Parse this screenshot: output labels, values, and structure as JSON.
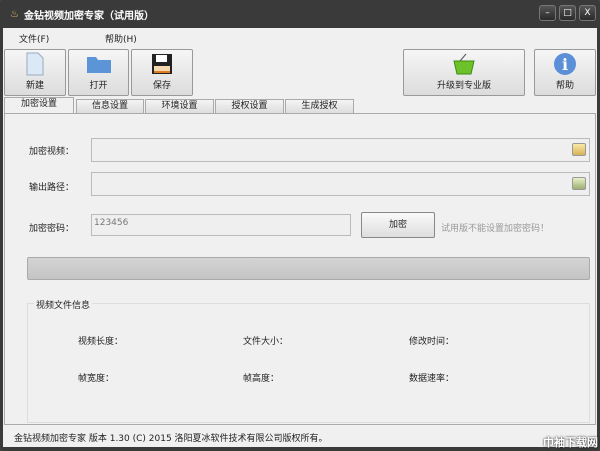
{
  "window": {
    "title": "金钻视频加密专家（试用版）",
    "minimize": "–",
    "maximize": "□",
    "close": "X"
  },
  "menu": [
    "文件(F)",
    "帮助(H)"
  ],
  "toolbar": {
    "new": "新建",
    "open": "打开",
    "save": "保存",
    "upgrade": "升级到专业版",
    "help": "帮助"
  },
  "tabs": [
    "加密设置",
    "信息设置",
    "环境设置",
    "授权设置",
    "生成授权"
  ],
  "form": {
    "video_label": "加密视频：",
    "video_value": "",
    "output_label": "输出路径：",
    "output_value": "",
    "password_label": "加密密码：",
    "password_value": "123456",
    "encrypt_button": "加密",
    "trial_hint": "试用版不能设置加密密码！"
  },
  "progress": 0,
  "info": {
    "title": "视频文件信息",
    "length": "视频长度：",
    "size": "文件大小：",
    "modified": "修改时间：",
    "width": "帧宽度：",
    "height": "帧高度：",
    "bitrate": "数据速率："
  },
  "status": "金钻视频加密专家  版本 1.30 (C)  2015 洛阳夏冰软件技术有限公司版权所有。",
  "watermark": "巾袖下载网"
}
